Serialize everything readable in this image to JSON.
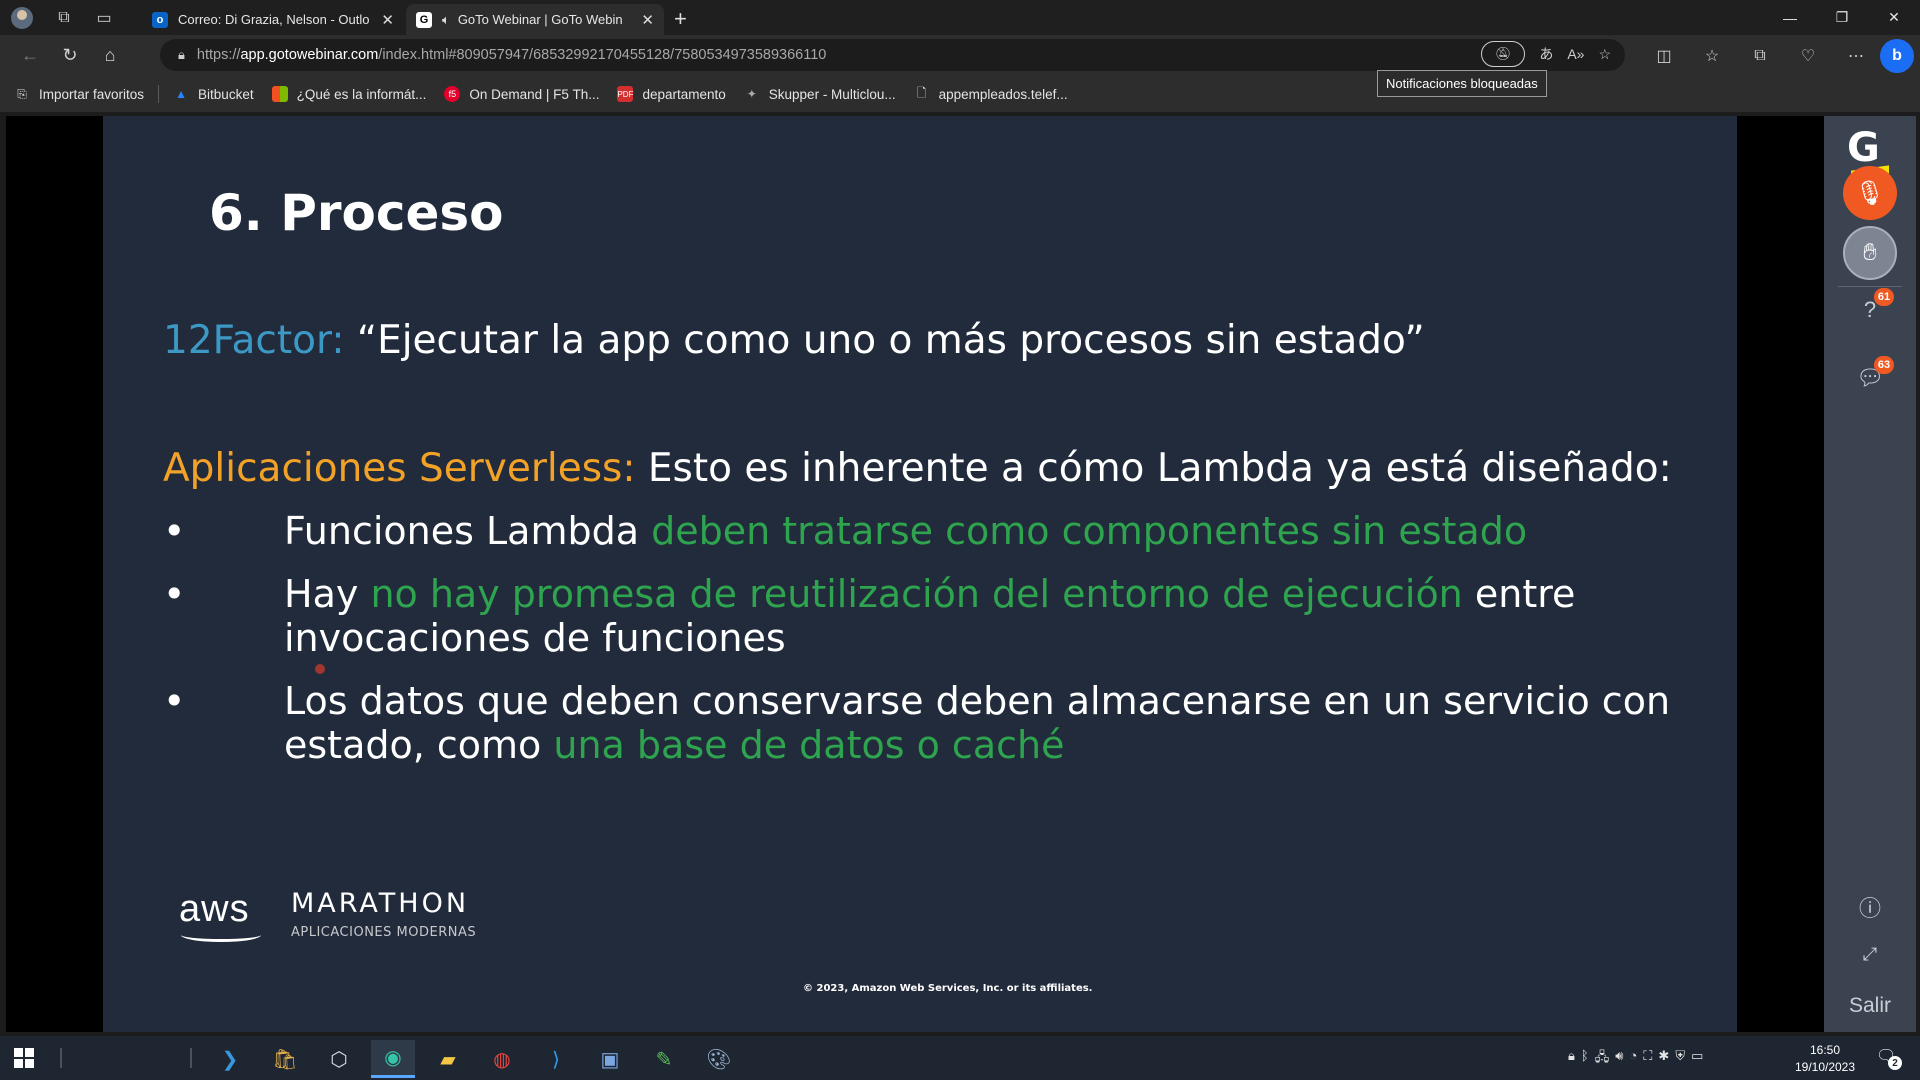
{
  "browser": {
    "tabs": [
      {
        "title": "Correo: Di Grazia, Nelson - Outlo",
        "favicon": "outlook-icon",
        "favicon_text": "o"
      },
      {
        "title": "GoTo Webinar | GoTo Webin",
        "favicon": "goto-icon",
        "favicon_text": "G"
      }
    ],
    "url_prefix": "https://",
    "url_host": "app.gotowebinar.com",
    "url_path": "/index.html#809057947/6853299217045512​8/7580534973589366110",
    "tooltip": "Notificaciones bloqueadas",
    "bookmarks": [
      {
        "label": "Importar favoritos",
        "icon": "import-icon"
      },
      {
        "label": "Bitbucket",
        "icon": "bitbucket-icon"
      },
      {
        "label": "¿Qué es la informát...",
        "icon": "microsoft-icon"
      },
      {
        "label": "On Demand | F5 Th...",
        "icon": "f5-icon"
      },
      {
        "label": "departamento",
        "icon": "pdf-icon"
      },
      {
        "label": "Skupper - Multiclou...",
        "icon": "skupper-icon"
      },
      {
        "label": "appempleados.telef...",
        "icon": "page-icon"
      }
    ]
  },
  "slide": {
    "title": "6. Proceso",
    "factor_label": "12Factor:",
    "factor_quote": " “Ejecutar la app como uno o más procesos sin estado”",
    "serverless_label": "Aplicaciones Serverless:",
    "serverless_text": " Esto es inherente a cómo Lambda ya está diseñado:",
    "bullets": [
      {
        "a": "Funciones Lambda ",
        "b": "deben tratarse como componentes sin estado",
        "c": "",
        "d": ""
      },
      {
        "a": "Hay ",
        "b": "no hay promesa de reutilización del entorno de ejecución",
        "c": " entre",
        "d": "invocaciones de funciones"
      },
      {
        "a": "Los datos que deben conservarse deben almacenarse en un servicio con",
        "b": "",
        "c": "estado, como ",
        "d": "una base de datos o caché"
      }
    ],
    "bullet_char": "•",
    "aws_text": "aws",
    "marathon": "MARATHON",
    "marathon_sub": "APLICACIONES MODERNAS",
    "copyright": "© 2023, Amazon Web Services, Inc. or its affiliates."
  },
  "goto_panel": {
    "logo": "G",
    "questions_count": "61",
    "chat_count": "63",
    "exit_label": "Salir"
  },
  "taskbar": {
    "time": "16:50",
    "date": "19/10/2023",
    "notifications": "2"
  },
  "colors": {
    "slide_bg": "#222b3b",
    "accent_blue": "#3c99c6",
    "accent_orange": "#f3a228",
    "accent_green": "#2ea44f",
    "goto_mic": "#f05a22",
    "goto_yellow": "#f5e100"
  }
}
